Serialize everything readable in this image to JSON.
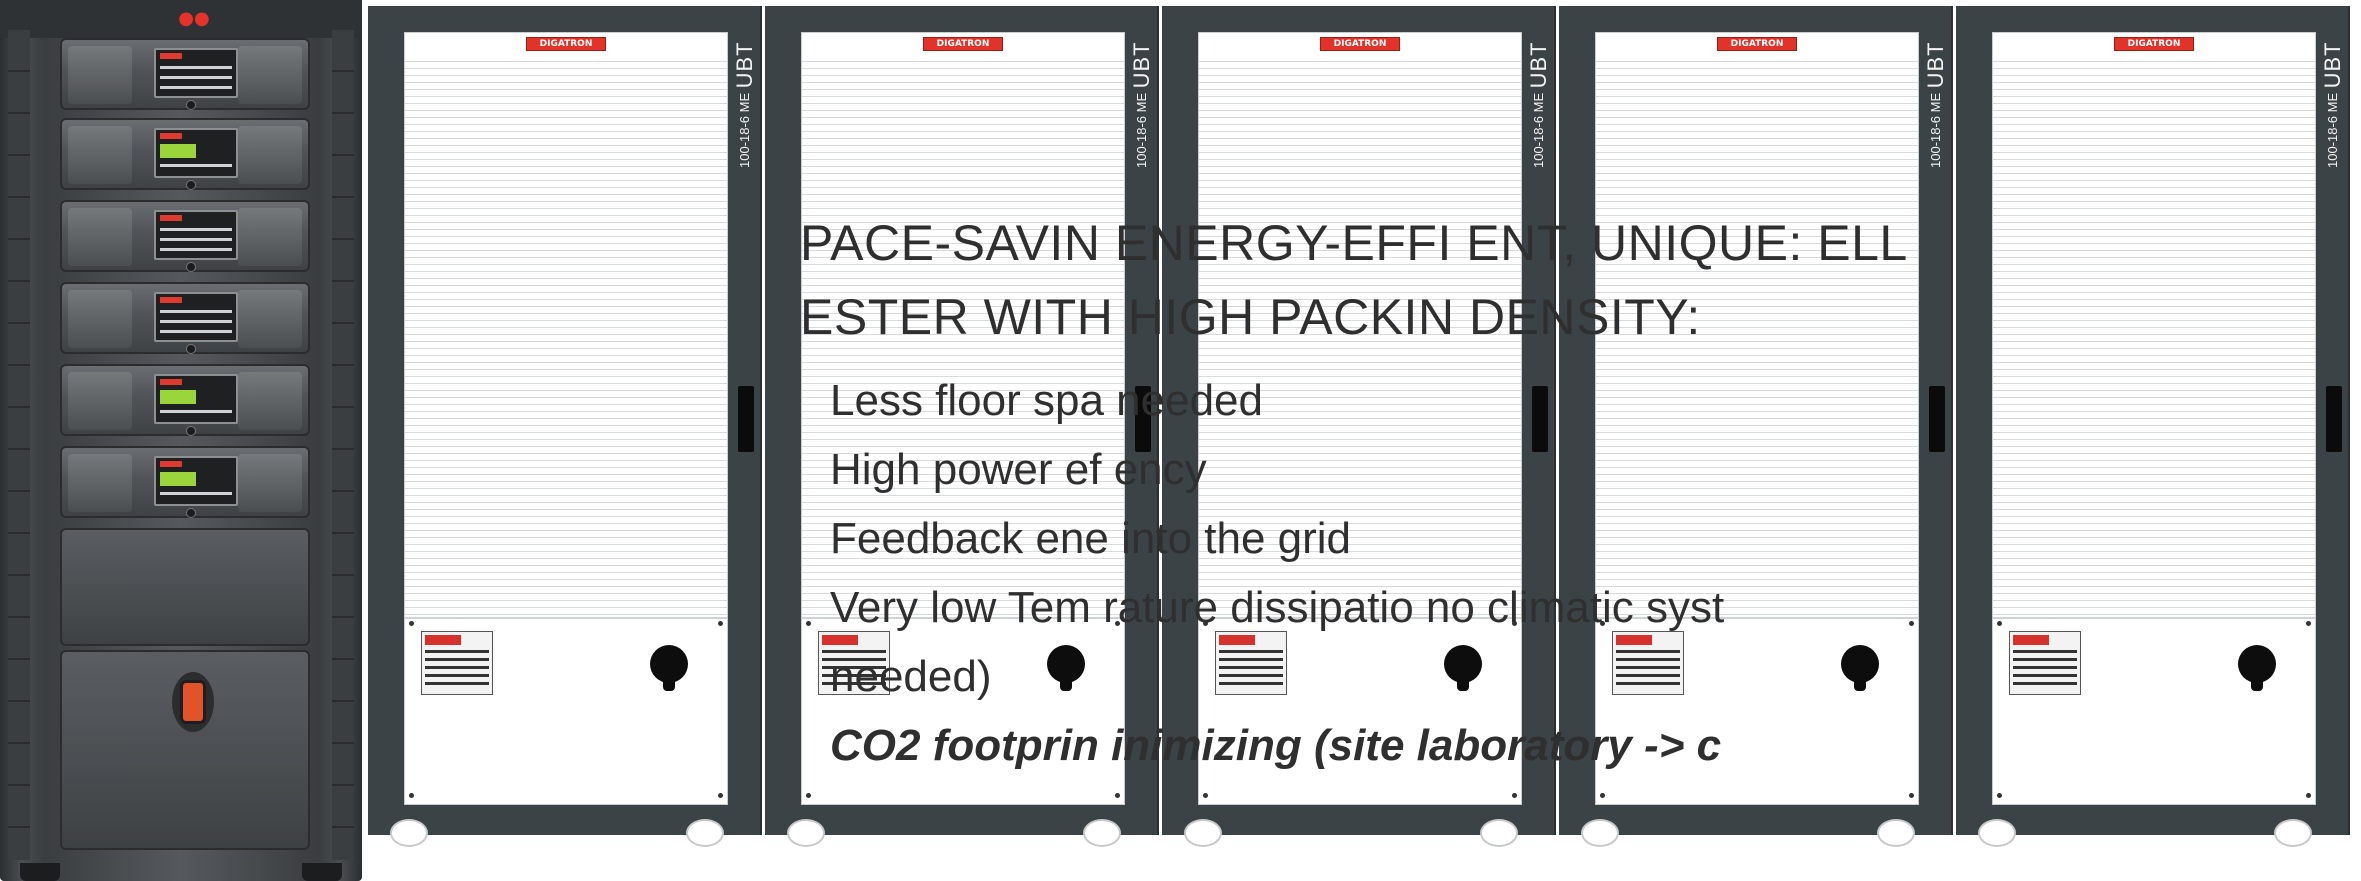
{
  "cabinets": [
    {
      "ubt_label": "UBT",
      "model_label": "100-18-6 ME",
      "logo_text": "DIGATRON"
    },
    {
      "ubt_label": "UBT",
      "model_label": "100-18-6 ME",
      "logo_text": "DIGATRON"
    },
    {
      "ubt_label": "UBT",
      "model_label": "100-18-6 ME",
      "logo_text": "DIGATRON"
    },
    {
      "ubt_label": "UBT",
      "model_label": "100-18-6 ME",
      "logo_text": "DIGATRON"
    },
    {
      "ubt_label": "UBT",
      "model_label": "100-18-6 ME",
      "logo_text": "DIGATRON"
    }
  ],
  "overlay": {
    "headline_line1": "PACE-SAVIN   ENERGY-EFFI   ENT, UNIQUE:   ELL",
    "headline_line2": "ESTER WITH   HIGH PACKIN   DENSITY:",
    "bullets": [
      "Less floor spa   needed",
      "High power ef     ency",
      "Feedback ene     into the grid",
      "Very low Tem     rature dissipatio   no climatic syst",
      "needed)"
    ],
    "emphasis": "CO2 footprin   inimizing (site    laboratory -> c"
  },
  "colors": {
    "cabinet_frame": "#3c4347",
    "door": "#ffffff",
    "brand_red": "#e2332b",
    "switch_orange": "#e2532a",
    "screen_green": "#9ad63b"
  }
}
